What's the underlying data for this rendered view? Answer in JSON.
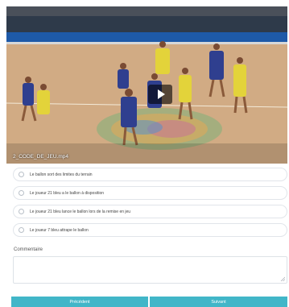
{
  "video": {
    "title": "2_CODE_DE_JEU.mp4",
    "play_icon": "play-icon"
  },
  "question": {
    "options": [
      {
        "label": "Le ballon sort des limites du terrain"
      },
      {
        "label": "Le joueur 21 bleu a le ballon à disposition"
      },
      {
        "label": "Le joueur 21 bleu lance le ballon lors de la remise en jeu"
      },
      {
        "label": "Le joueur 7 bleu attrape le ballon"
      }
    ]
  },
  "comment": {
    "label": "Commentaire",
    "value": ""
  },
  "navigation": {
    "prev_label": "Précédent",
    "next_label": "Suivant"
  },
  "colors": {
    "accent": "#41b6c8",
    "team_blue": "#2f3f8f",
    "team_yellow": "#e3d33a"
  }
}
